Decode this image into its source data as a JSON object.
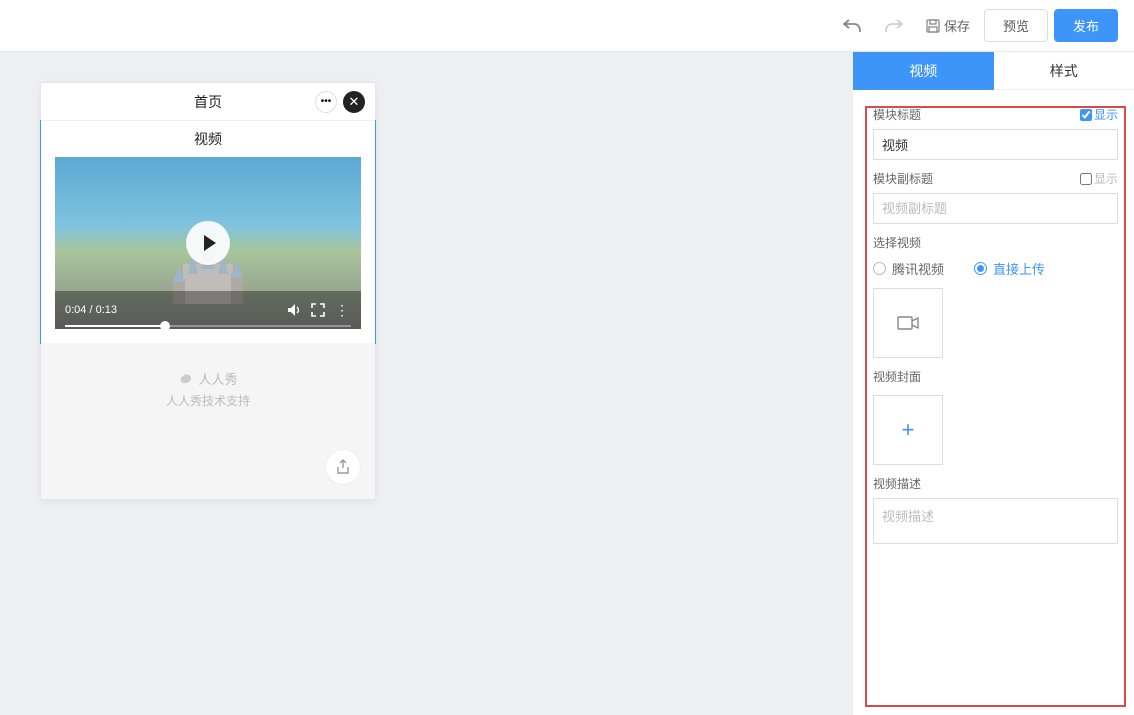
{
  "header": {
    "save": "保存",
    "preview": "预览",
    "publish": "发布"
  },
  "preview": {
    "page_title": "首页",
    "module_title": "视频",
    "video_time": "0:04 / 0:13",
    "brand": "人人秀",
    "brand_sub": "人人秀技术支持"
  },
  "panel": {
    "tabs": {
      "video": "视频",
      "style": "样式"
    },
    "module_title": {
      "label": "模块标题",
      "show_label": "显示",
      "value": "视频"
    },
    "module_subtitle": {
      "label": "模块副标题",
      "show_label": "显示",
      "placeholder": "视频副标题"
    },
    "select_video": {
      "label": "选择视频",
      "options": {
        "tencent": "腾讯视频",
        "upload": "直接上传"
      },
      "selected": "upload"
    },
    "video_cover": {
      "label": "视频封面"
    },
    "video_desc": {
      "label": "视频描述",
      "placeholder": "视频描述"
    }
  }
}
